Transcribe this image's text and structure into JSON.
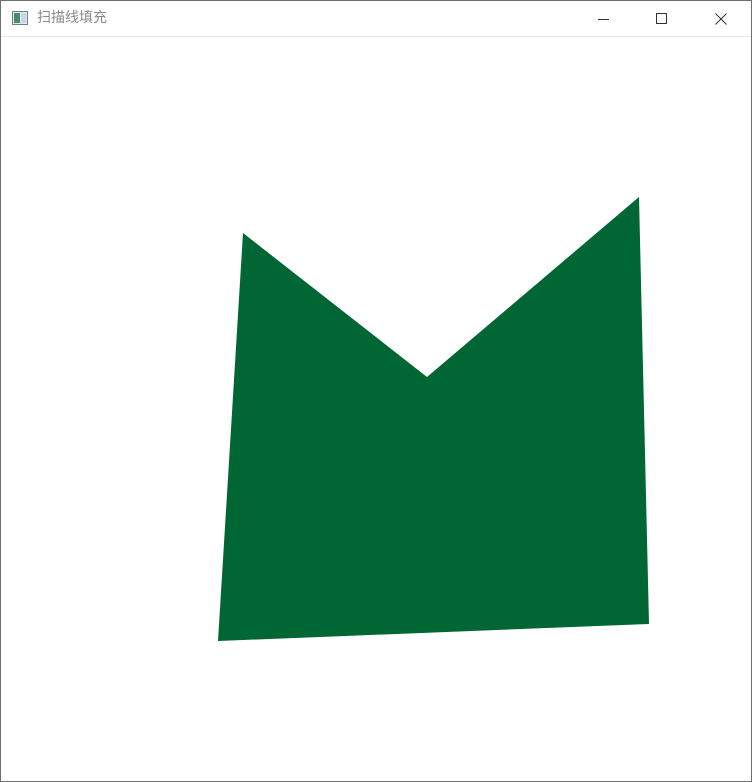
{
  "window": {
    "title": "扫描线填充",
    "controls": {
      "minimize_icon": "minimize-icon",
      "maximize_icon": "maximize-icon",
      "close_icon": "close-icon"
    }
  },
  "canvas": {
    "fill_color": "#006633",
    "background_color": "#ffffff"
  }
}
